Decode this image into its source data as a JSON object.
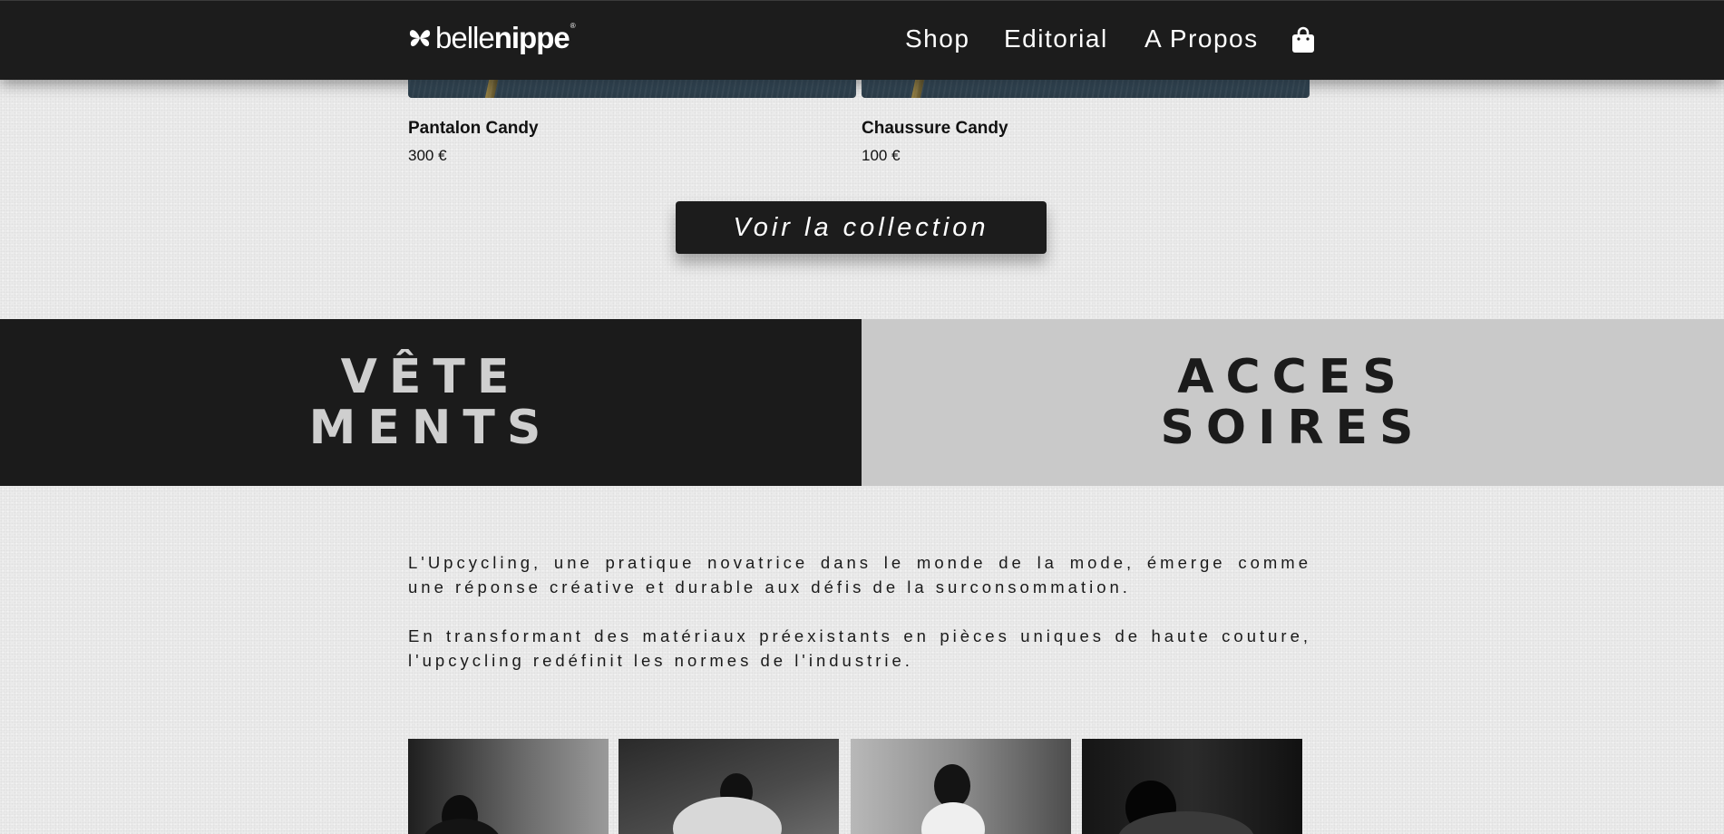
{
  "header": {
    "logo": {
      "light": "belle",
      "bold": "nippe",
      "mark": "®"
    },
    "nav": [
      {
        "label": "Shop"
      },
      {
        "label": "Editorial"
      },
      {
        "label": "A Propos"
      }
    ],
    "cart_icon": "shopping-bag-icon"
  },
  "products": [
    {
      "name": "Pantalon Candy",
      "price": "300 €"
    },
    {
      "name": "Chaussure Candy",
      "price": "100 €"
    }
  ],
  "cta": {
    "label": "Voir la collection"
  },
  "categories": [
    {
      "line1": "VÊTE",
      "line2": "MENTS"
    },
    {
      "line1": "ACCES",
      "line2": "SOIRES"
    }
  ],
  "intro": {
    "p1": "L'Upcycling, une pratique novatrice dans le monde de la mode, émerge comme une réponse créative et durable aux défis de la surconsommation.",
    "p2": "En transformant des matériaux préexistants en pièces uniques de haute couture, l'upcycling redéfinit les normes de l'industrie."
  },
  "colors": {
    "header_bg": "#1c1c1c",
    "page_bg": "#ececec",
    "dark_panel": "#1b1b1b",
    "light_panel": "#c9c9c9"
  }
}
